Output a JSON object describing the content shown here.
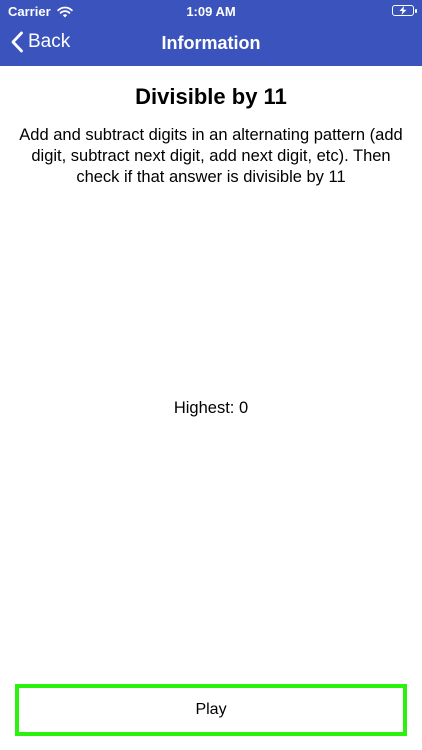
{
  "status_bar": {
    "carrier": "Carrier",
    "time": "1:09 AM"
  },
  "nav": {
    "back_label": "Back",
    "title": "Information"
  },
  "content": {
    "heading": "Divisible by 11",
    "description": "Add and subtract digits in an alternating pattern (add digit, subtract next digit, add next digit, etc). Then check if that answer is divisible by 11",
    "highest_label": "Highest: ",
    "highest_value": "0"
  },
  "actions": {
    "play_label": "Play"
  },
  "colors": {
    "bar_blue": "#3a53bd",
    "play_border": "#2bf20d"
  }
}
